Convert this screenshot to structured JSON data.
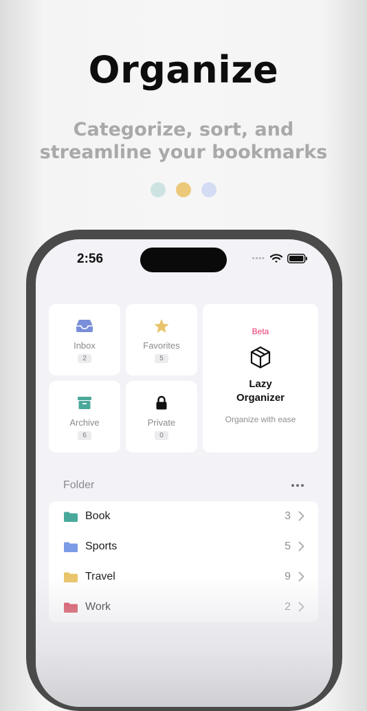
{
  "headline": "Organize",
  "subtitle": "Categorize, sort, and streamline your bookmarks",
  "page_dots": [
    {
      "color": "#cde3e2"
    },
    {
      "color": "#ecc97a"
    },
    {
      "color": "#d4dcf3"
    }
  ],
  "status_bar": {
    "time": "2:56"
  },
  "tiles": {
    "inbox": {
      "label": "Inbox",
      "count": "2",
      "icon": "tray-icon",
      "color": "#7a8fd9"
    },
    "favorites": {
      "label": "Favorites",
      "count": "5",
      "icon": "star-icon",
      "color": "#e9c46a"
    },
    "archive": {
      "label": "Archive",
      "count": "6",
      "icon": "archive-box-icon",
      "color": "#4aa89a"
    },
    "private": {
      "label": "Private",
      "count": "0",
      "icon": "lock-icon",
      "color": "#111111"
    }
  },
  "lazy_organizer": {
    "badge": "Beta",
    "title_line1": "Lazy",
    "title_line2": "Organizer",
    "subtitle": "Organize with ease",
    "icon": "package-icon"
  },
  "folders": {
    "heading": "Folder",
    "items": [
      {
        "name": "Book",
        "count": "3",
        "color": "#48a99b"
      },
      {
        "name": "Sports",
        "count": "5",
        "color": "#7b9be6"
      },
      {
        "name": "Travel",
        "count": "9",
        "color": "#e9c46a"
      },
      {
        "name": "Work",
        "count": "2",
        "color": "#d33a4e"
      }
    ]
  }
}
